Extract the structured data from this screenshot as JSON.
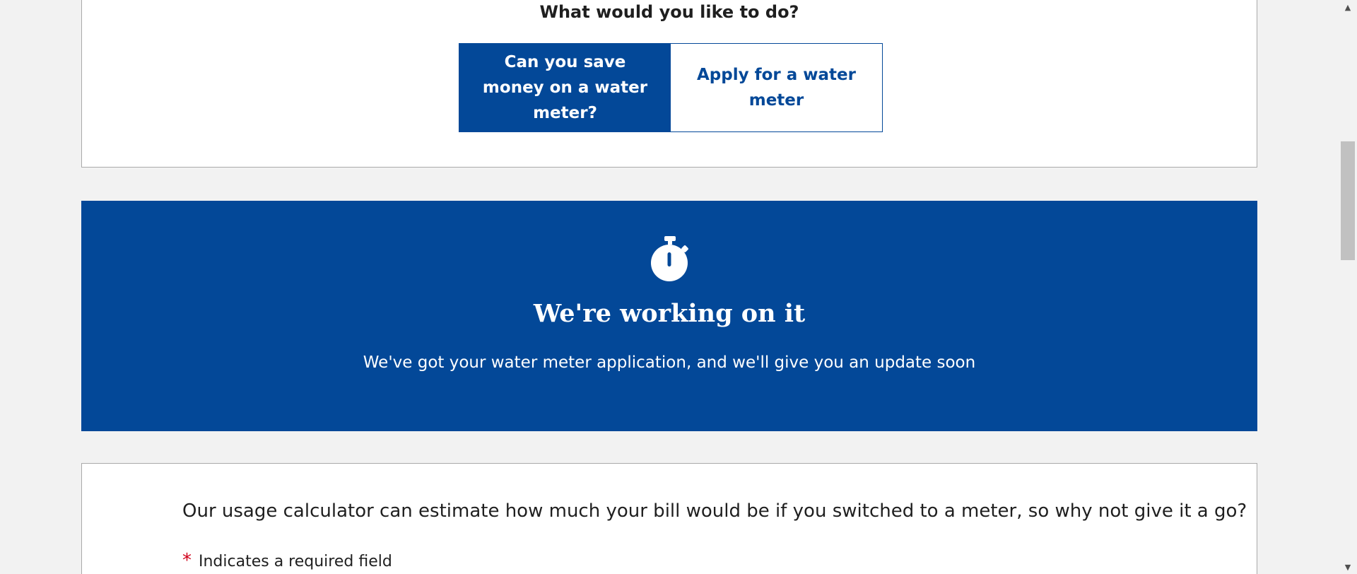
{
  "choice": {
    "title": "What would you like to do?",
    "active_button": "Can you save money on a water meter?",
    "secondary_button": "Apply for a water meter"
  },
  "status": {
    "icon": "stopwatch-icon",
    "title": "We're working on it",
    "message": "We've got your water meter application, and we'll give you an update soon"
  },
  "calculator": {
    "intro": "Our usage calculator can estimate how much your bill would be if you switched to a meter, so why not give it a go?",
    "required_marker": "*",
    "required_note": "Indicates a required field"
  },
  "colors": {
    "brand_blue": "#034898",
    "background": "#f2f2f2",
    "required_red": "#d0021b"
  }
}
